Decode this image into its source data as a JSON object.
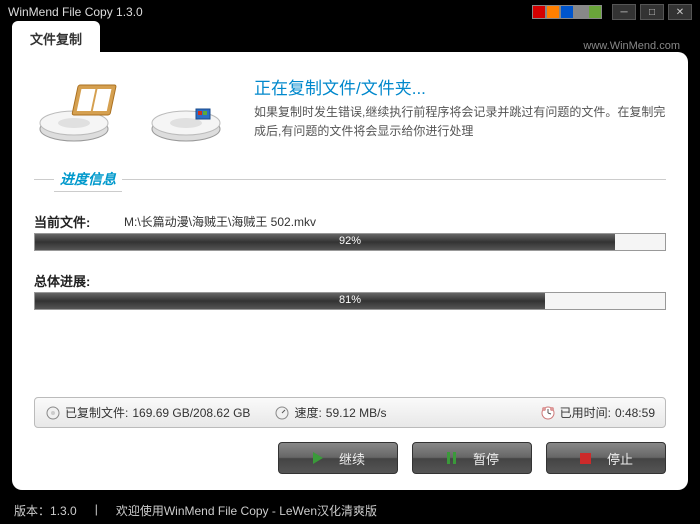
{
  "titlebar": {
    "title": "WinMend File Copy 1.3.0"
  },
  "colors": [
    "#d40000",
    "#ff7f00",
    "#0055cc",
    "#888",
    "#6aa53a"
  ],
  "url": "www.WinMend.com",
  "tab": {
    "label": "文件复制"
  },
  "action": {
    "title": "正在复制文件/文件夹...",
    "desc": "如果复制时发生错误,继续执行前程序将会记录并跳过有问题的文件。在复制完成后,有问题的文件将会显示给你进行处理"
  },
  "section_label": "进度信息",
  "current": {
    "label": "当前文件:",
    "value": "M:\\长篇动漫\\海贼王\\海贼王 502.mkv",
    "percent": 92,
    "percent_text": "92%"
  },
  "overall": {
    "label": "总体进展:",
    "percent": 81,
    "percent_text": "81%"
  },
  "stats": {
    "copied_label": "已复制文件:",
    "copied_value": "169.69 GB/208.62 GB",
    "speed_label": "速度:",
    "speed_value": "59.12 MB/s",
    "elapsed_label": "已用时间:",
    "elapsed_value": "0:48:59"
  },
  "buttons": {
    "continue": "继续",
    "pause": "暂停",
    "stop": "停止"
  },
  "footer": {
    "version_label": "版本：",
    "version_value": "1.3.0",
    "welcome": "欢迎使用WinMend File Copy - LeWen汉化清爽版"
  }
}
